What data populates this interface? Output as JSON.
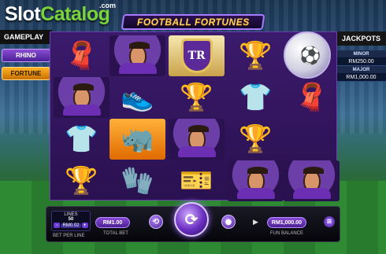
{
  "brand": {
    "name_a": "Slot",
    "name_b": "Catalog",
    "suffix": ".com"
  },
  "game": {
    "title": "FOOTBALL FORTUNES"
  },
  "left_panel": {
    "tab_label": "GAMEPLAY",
    "modes": [
      {
        "label": "RHINO"
      },
      {
        "label": "FORTUNE"
      }
    ]
  },
  "jackpots": {
    "header": "JACKPOTS",
    "minor_label": "MINOR",
    "minor_value": "RM250.00",
    "major_label": "MAJOR",
    "major_value": "RM1,000.00"
  },
  "symbols": [
    {
      "icon": "scarf-icon"
    },
    {
      "icon": "goalkeeper-icon"
    },
    {
      "icon": "club-logo-icon"
    },
    {
      "icon": "trophy-icon"
    },
    {
      "icon": "player-icon"
    },
    {
      "icon": "boot-icon"
    },
    {
      "icon": "trophy-icon"
    },
    {
      "icon": "jersey-icon"
    },
    {
      "icon": "scarf-icon"
    },
    {
      "icon": "jersey-icon"
    },
    {
      "icon": "rhino-icon"
    },
    {
      "icon": "player-icon"
    },
    {
      "icon": "trophy-icon"
    },
    {
      "icon": "gloves-icon"
    },
    {
      "icon": "card-icon"
    },
    {
      "icon": "goalkeeper-icon"
    },
    {
      "icon": "player-icon"
    },
    {
      "icon": "trophy-icon"
    }
  ],
  "controls": {
    "lines_label": "LINES",
    "lines_value": "50",
    "bet_per_line_value": "RM0.02",
    "bet_per_line_label": "BET PER LINE",
    "total_bet_value": "RM1.00",
    "total_bet_label": "TOTAL BET",
    "fun_balance_value": "RM1,000.00",
    "fun_balance_label": "FUN BALANCE",
    "minus": "-",
    "plus": "+"
  }
}
